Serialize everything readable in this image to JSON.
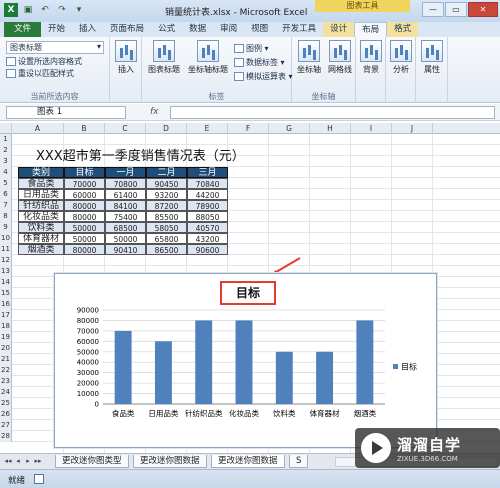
{
  "window": {
    "title": "销量统计表.xlsx - Microsoft Excel",
    "context_tab_group": "图表工具",
    "controls": {
      "minimize": "—",
      "restore": "▭",
      "close": "✕"
    }
  },
  "ribbon_tabs": [
    "文件",
    "开始",
    "插入",
    "页面布局",
    "公式",
    "数据",
    "审阅",
    "视图",
    "开发工具",
    "设计",
    "布局",
    "格式"
  ],
  "ribbon": {
    "selection_group": {
      "dropdown_value": "图表标题",
      "format_selection": "设置所选内容格式",
      "reset_style": "重设以匹配样式",
      "label": "当前所选内容"
    },
    "insert_group": {
      "button": "插入"
    },
    "labels_group": {
      "chart_title": "图表标题",
      "axis_title": "坐标轴标题",
      "legend": "图例",
      "data_labels": "数据标签",
      "data_table": "模拟运算表",
      "label": "标签"
    },
    "axes_group": {
      "axes": "坐标轴",
      "gridlines": "网格线",
      "label": "坐标轴"
    },
    "background_group": {
      "button": "背景"
    },
    "analysis_group": {
      "button": "分析"
    },
    "properties_group": {
      "button": "属性"
    }
  },
  "formula_bar": {
    "name_box": "图表 1",
    "fx": "fx",
    "formula": ""
  },
  "columns": [
    "A",
    "B",
    "C",
    "D",
    "E",
    "F",
    "G",
    "H",
    "I",
    "J"
  ],
  "rows": [
    "1",
    "2",
    "3",
    "4",
    "5",
    "6",
    "7",
    "8",
    "9",
    "10",
    "11",
    "12",
    "13",
    "14",
    "15",
    "16",
    "17",
    "18",
    "19",
    "20",
    "21",
    "22",
    "23",
    "24",
    "25",
    "26",
    "27",
    "28"
  ],
  "table": {
    "title": "XXX超市第一季度销售情况表（元）",
    "headers": [
      "类别",
      "目标",
      "一月",
      "二月",
      "三月"
    ],
    "rows": [
      [
        "食品类",
        "70000",
        "70800",
        "90450",
        "70840"
      ],
      [
        "日用品类",
        "60000",
        "61400",
        "93200",
        "44200"
      ],
      [
        "针纺织品类",
        "80000",
        "84100",
        "87200",
        "78900"
      ],
      [
        "化妆品类",
        "80000",
        "75400",
        "85500",
        "88050"
      ],
      [
        "饮料类",
        "50000",
        "68500",
        "58050",
        "40570"
      ],
      [
        "体育器材",
        "50000",
        "50000",
        "65800",
        "43200"
      ],
      [
        "烟酒类",
        "80000",
        "90410",
        "86500",
        "90600"
      ]
    ]
  },
  "chart_data": {
    "type": "bar",
    "title": "目标",
    "categories": [
      "食品类",
      "日用品类",
      "针纺织品类",
      "化妆品类",
      "饮料类",
      "体育器材",
      "烟酒类"
    ],
    "series": [
      {
        "name": "目标",
        "values": [
          70000,
          60000,
          80000,
          80000,
          50000,
          50000,
          80000
        ]
      }
    ],
    "ylim": [
      0,
      90000
    ],
    "yticks": [
      "0",
      "10000",
      "20000",
      "30000",
      "40000",
      "50000",
      "60000",
      "70000",
      "80000",
      "90000"
    ],
    "grid": true,
    "legend": "right",
    "colors": {
      "bar": "#4f81bd",
      "grid": "#d9d9d9",
      "title_box": "#e23e30"
    }
  },
  "sheet_tabs": [
    "更改迷你图类型",
    "更改迷你图数据",
    "更改迷你图数据",
    "S"
  ],
  "sheet_nav": [
    "◂◂",
    "◂",
    "▸",
    "▸▸"
  ],
  "status": {
    "ready": "就绪"
  },
  "watermark": {
    "brand": "溜溜自学",
    "url": "ZIXUE.3D66.COM"
  }
}
